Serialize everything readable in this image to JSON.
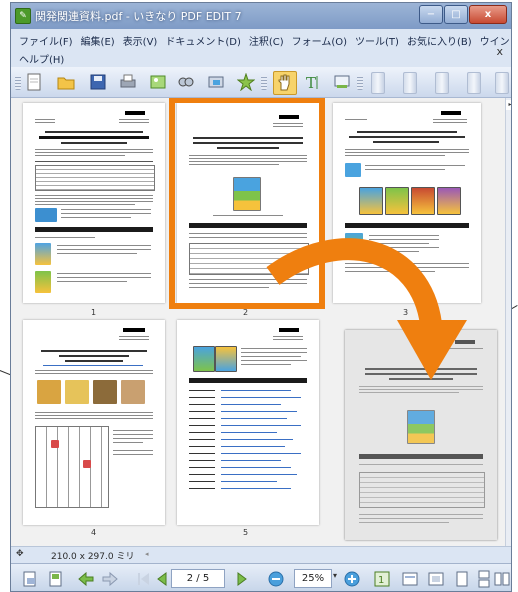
{
  "window": {
    "title": "関発関連資料.pdf - いきなり PDF EDIT 7",
    "controls": {
      "minimize": "−",
      "maximize": "□",
      "close": "x"
    }
  },
  "menu": {
    "row1": [
      "ファイル(F)",
      "編集(E)",
      "表示(V)",
      "ドキュメント(D)",
      "注釈(C)",
      "フォーム(O)",
      "ツール(T)",
      "お気に入り(B)",
      "ウインドウ(W)"
    ],
    "row2": [
      "ヘルプ(H)"
    ],
    "close_label": "x"
  },
  "toolbar": {
    "icons": [
      "new-document-icon",
      "open-folder-icon",
      "save-icon",
      "print-icon",
      "image-icon",
      "find-icon",
      "scan-icon",
      "favorite-star-icon",
      "hand-tool-icon",
      "text-tool-icon",
      "snapshot-icon"
    ],
    "accent": "#f0b429"
  },
  "pages": [
    {
      "number": "1"
    },
    {
      "number": "2",
      "selected": true
    },
    {
      "number": "3"
    },
    {
      "number": "4"
    },
    {
      "number": "5"
    }
  ],
  "selection": {
    "frame_color": "#ef7f0f",
    "arrow_color": "#ef7f0f"
  },
  "status": {
    "page_size": "210.0 x 297.0 ミリ"
  },
  "navigation": {
    "page_indicator": "2 / 5",
    "zoom": "25%",
    "zoom_dropdown": "▾"
  }
}
